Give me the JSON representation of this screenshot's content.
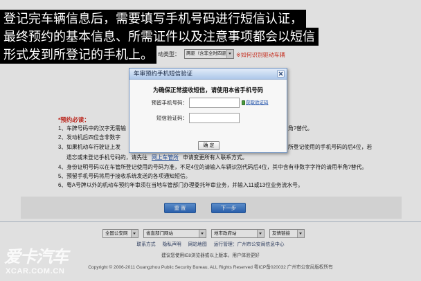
{
  "caption": {
    "lines": [
      "登记完车辆信息后，需要填写手机号码进行短信认证，",
      "最终预约的基本信息、所需证件以及注意事项都会以短信",
      "形式发到所登记的手机上。"
    ]
  },
  "form": {
    "drive_type_label": "动类型：",
    "drive_type_value": "两驱（含非全时四驱）",
    "drive_type_help": "※如何识别驱动车辆"
  },
  "notice": {
    "title": "*预约必读：",
    "rows": [
      {
        "left": "1、车牌号码中的汉字无需输",
        "right": "角?替代。"
      },
      {
        "left": "2、发动机后四位含非数字"
      },
      {
        "left": "3、如果机动车行驶证上发",
        "right": "所登记使用的手机号码的后4位，若"
      }
    ],
    "row3_cont": {
      "prefix": "遗忘或未登记手机号码的，请先往",
      "link": "网上车管所",
      "suffix": "申请变更所有人联系方式。"
    },
    "row4": "4、身份证明号码以在车管所登记使用的号码为准，不足4位的请输入车辆识别代码后4位，其中含有非数字字符的请用半角?替代。",
    "row5": "5、预留手机号码将用于接收系统发送的各项通知短信。",
    "row6": "6、粤A号牌以外的机动车预约年审须在当地车管部门办理委托年审业务，并输入11或13位业务流水号。"
  },
  "actions": {
    "reset": "重 置",
    "next": "下一步"
  },
  "modal": {
    "title": "年审预约手机短信验证",
    "notice": "为确保正常接收短信，请使用本省手机号码",
    "phone_label": "预留手机号码：",
    "phone_value": "",
    "get_code": "获取验证码",
    "code_label": "短信验证码：",
    "code_value": "",
    "confirm": "确 定"
  },
  "footer": {
    "selects": [
      "全国公安网",
      "省直部门网站",
      "地市政府站",
      "友情链接"
    ],
    "links": [
      "联系方式",
      "隐私声明",
      "网站地图"
    ],
    "operator": "运行管理：广州市公安局信息中心",
    "browser_tip": "建议您使用IE8浏览器或以上版本，用户体验更好",
    "copyright": "Copyright © 2006-2011 Guangzhou Public Security Bureau, ALL Rights Reserved 粤ICP备020032 广州市公安局版权所有"
  },
  "watermark": {
    "brand": "爱卡汽车",
    "domain": "XCAR.COM.CN"
  },
  "icons": {
    "close": "close-icon",
    "dropdown": "dropdown-arrow-icon",
    "sms": "sms-icon"
  },
  "colors": {
    "accent_blue": "#2f6cc2",
    "notice_red": "#d42a1f",
    "link_blue": "#1d4fa8",
    "caption_bg": "#000000",
    "modal_title_bg": "#aec8ea"
  }
}
